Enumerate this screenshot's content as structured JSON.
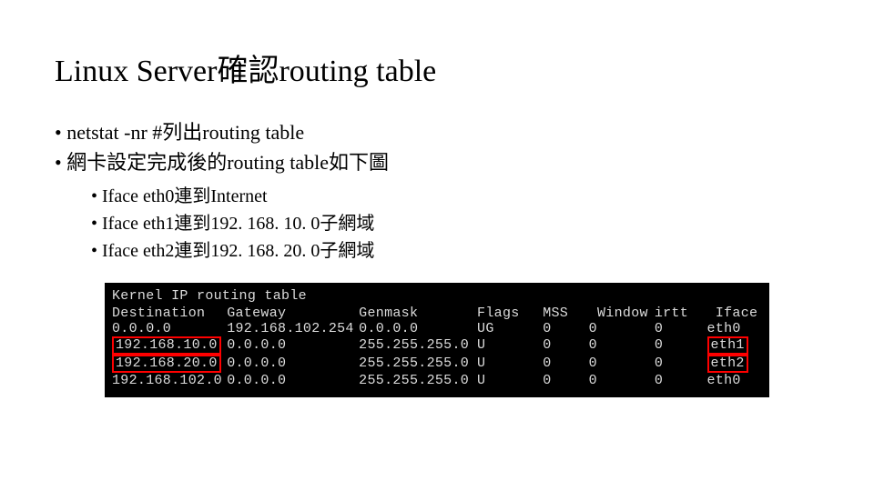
{
  "title": "Linux Server確認routing table",
  "bullets": {
    "b1": "netstat -nr  #列出routing table",
    "b2": "網卡設定完成後的routing table如下圖",
    "s1": "Iface eth0連到Internet",
    "s2": "Iface eth1連到192. 168. 10. 0子網域",
    "s3": "Iface eth2連到192. 168. 20. 0子網域"
  },
  "terminal": {
    "header": "Kernel IP routing table",
    "cols": {
      "dest": "Destination",
      "gw": "Gateway",
      "mask": "Genmask",
      "flags": "Flags",
      "mss": "MSS",
      "window": "Window",
      "irtt": "irtt",
      "iface": "Iface"
    },
    "rows": [
      {
        "dest": "0.0.0.0",
        "gw": "192.168.102.254",
        "mask": "0.0.0.0",
        "flags": "UG",
        "mss": "0",
        "window": "0",
        "irtt": "0",
        "iface": "eth0",
        "hl_dest": false,
        "hl_iface": false
      },
      {
        "dest": "192.168.10.0",
        "gw": "0.0.0.0",
        "mask": "255.255.255.0",
        "flags": "U",
        "mss": "0",
        "window": "0",
        "irtt": "0",
        "iface": "eth1",
        "hl_dest": true,
        "hl_iface": true
      },
      {
        "dest": "192.168.20.0",
        "gw": "0.0.0.0",
        "mask": "255.255.255.0",
        "flags": "U",
        "mss": "0",
        "window": "0",
        "irtt": "0",
        "iface": "eth2",
        "hl_dest": true,
        "hl_iface": true
      },
      {
        "dest": "192.168.102.0",
        "gw": "0.0.0.0",
        "mask": "255.255.255.0",
        "flags": "U",
        "mss": "0",
        "window": "0",
        "irtt": "0",
        "iface": "eth0",
        "hl_dest": false,
        "hl_iface": false
      }
    ]
  }
}
